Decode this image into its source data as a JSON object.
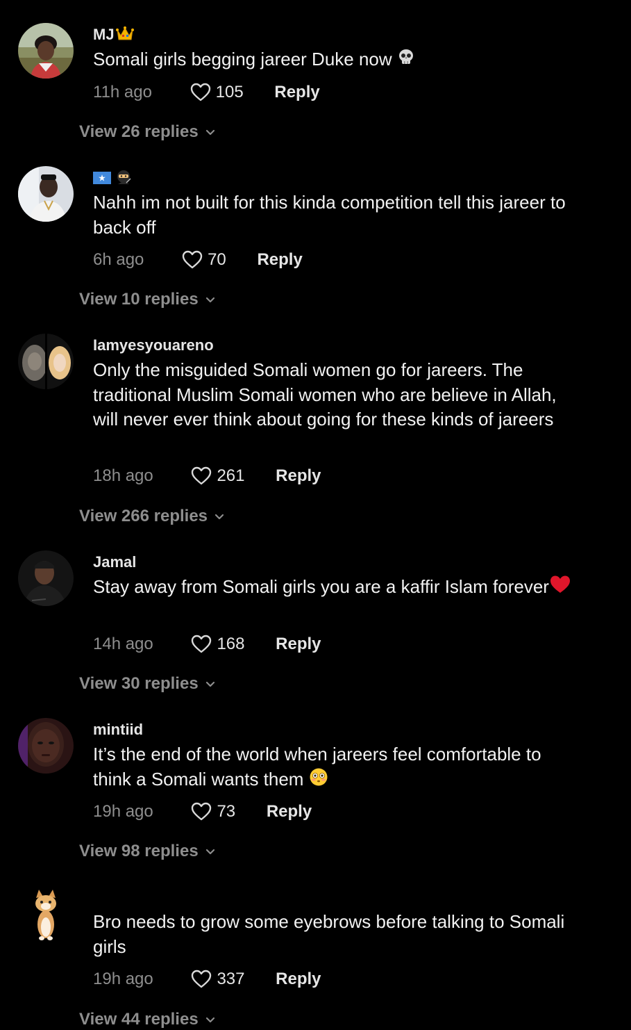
{
  "comments": [
    {
      "username": "MJ",
      "username_emoji": "crown-emoji",
      "text": "Somali girls begging jareer Duke now",
      "text_emoji": "skull-emoji",
      "time": "11h ago",
      "likes": "105",
      "reply_label": "Reply",
      "view_replies": "View 26 replies"
    },
    {
      "username": "",
      "username_emoji": "somalia-flag-ninja-emoji",
      "text": "Nahh im not built for this kinda competition tell this jareer to back off",
      "time": "6h ago",
      "likes": "70",
      "reply_label": "Reply",
      "view_replies": "View 10 replies"
    },
    {
      "username": "Iamyesyouareno",
      "text": "Only the misguided Somali women go for jareers. The traditional Muslim Somali women who are believe in Allah, will never ever think about going for these kinds of jareers",
      "time": "18h ago",
      "likes": "261",
      "reply_label": "Reply",
      "view_replies": "View 266 replies"
    },
    {
      "username": "Jamal",
      "text": "Stay away from Somali girls you are a kaffir Islam forever",
      "text_emoji": "red-heart-emoji",
      "time": "14h ago",
      "likes": "168",
      "reply_label": "Reply",
      "view_replies": "View 30 replies"
    },
    {
      "username": "mintiid",
      "text": "It’s the end of the world when jareers feel comfortable to think a Somali wants them",
      "text_emoji": "flushed-face-emoji",
      "time": "19h ago",
      "likes": "73",
      "reply_label": "Reply",
      "view_replies": "View 98 replies"
    },
    {
      "username": "",
      "text": "Bro needs to grow some eyebrows before talking to Somali girls",
      "time": "19h ago",
      "likes": "337",
      "reply_label": "Reply",
      "view_replies": "View 44 replies"
    }
  ],
  "colors": {
    "background": "#000000",
    "primary_text": "#f2f2f2",
    "secondary_text": "#8e8e8e"
  }
}
